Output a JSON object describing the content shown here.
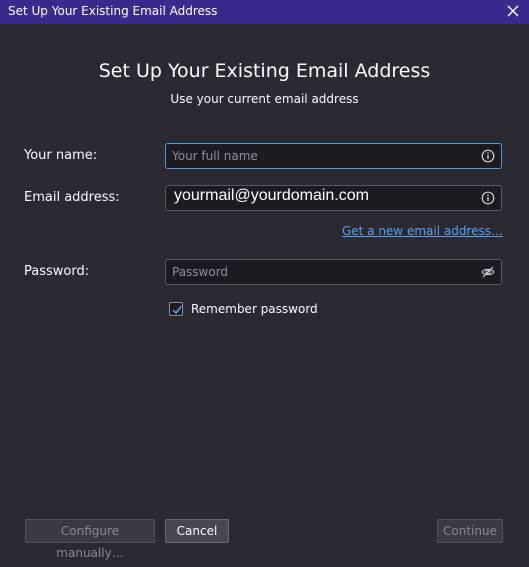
{
  "window": {
    "title": "Set Up Your Existing Email Address"
  },
  "header": {
    "title": "Set Up Your Existing Email Address",
    "subtitle": "Use your current email address"
  },
  "form": {
    "name": {
      "label": "Your name:",
      "placeholder": "Your full name",
      "value": ""
    },
    "email": {
      "label": "Email address:",
      "value": "yourmail@yourdomain.com"
    },
    "new_email_link": "Get a new email address…",
    "password": {
      "label": "Password:",
      "placeholder": "Password",
      "value": ""
    },
    "remember": {
      "label": "Remember password",
      "checked": true
    }
  },
  "buttons": {
    "configure": "Configure manually…",
    "cancel": "Cancel",
    "continue": "Continue"
  },
  "icons": {
    "close": "close-icon",
    "info": "info-icon",
    "eye_off": "eye-off-icon",
    "check": "checkmark-icon"
  },
  "colors": {
    "titlebar": "#3b2a8e",
    "background": "#2b2a33",
    "link": "#54a0f5",
    "focus": "#4f9bd6"
  }
}
